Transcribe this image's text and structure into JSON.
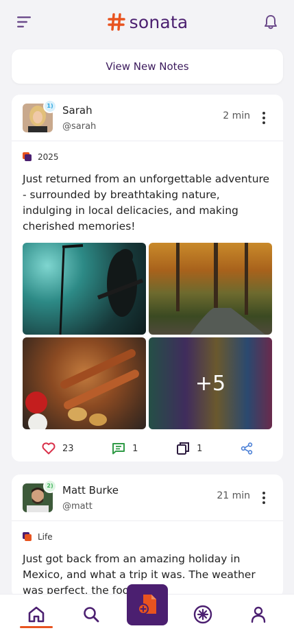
{
  "app": {
    "name": "sonata"
  },
  "feed": {
    "view_new_label": "View New Notes"
  },
  "posts": [
    {
      "user_name": "Sarah",
      "handle": "@sarah",
      "rank": "1",
      "time": "2 min",
      "tag": "2025",
      "text": "Just returned from an unforgettable adventure - surrounded by breathtaking nature, indulging in local delicacies, and making cherished memories!",
      "more_photos": "+5",
      "likes": "23",
      "comments": "1",
      "reposts": "1"
    },
    {
      "user_name": "Matt Burke",
      "handle": "@matt",
      "rank": "2",
      "time": "21 min",
      "tag": "Life",
      "text": "Just got back from an amazing holiday in Mexico, and what a trip it was. The weather was perfect, the food was"
    }
  ],
  "colors": {
    "brand_purple": "#4b1f70",
    "brand_orange": "#e8531f",
    "like_red": "#d9314a",
    "comment_green": "#2e9a45",
    "share_blue": "#4a7fd6",
    "rank1_blue": "#2aa5e0",
    "rank2_green": "#3fb55a"
  },
  "icons": {
    "menu": "menu-icon",
    "notifications": "bell-icon",
    "home": "home-icon",
    "search": "search-icon",
    "create": "add-note-icon",
    "discover": "starburst-icon",
    "profile": "user-icon",
    "like": "heart-icon",
    "comment": "comment-icon",
    "repost": "repost-icon",
    "share": "share-icon",
    "more": "more-vertical-icon"
  }
}
